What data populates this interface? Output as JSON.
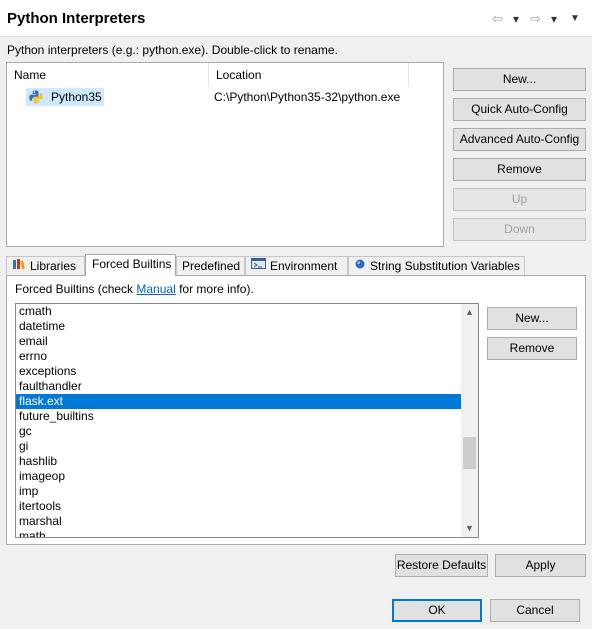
{
  "header": {
    "title": "Python Interpreters",
    "back_icon": "⇦",
    "forward_icon": "⇨",
    "dropdown_icon": "▾",
    "menu_icon": "▼"
  },
  "description": "Python interpreters (e.g.: python.exe).   Double-click to rename.",
  "interpreters_table": {
    "columns": [
      "Name",
      "Location"
    ],
    "rows": [
      {
        "name": "Python35",
        "location": "C:\\Python\\Python35-32\\python.exe"
      }
    ]
  },
  "side_buttons": {
    "new": "New...",
    "quick_auto_config": "Quick Auto-Config",
    "advanced_auto_config": "Advanced Auto-Config",
    "remove": "Remove",
    "up": "Up",
    "down": "Down"
  },
  "tabs": [
    {
      "label": "Libraries",
      "active": false
    },
    {
      "label": "Forced Builtins",
      "active": true
    },
    {
      "label": "Predefined",
      "active": false
    },
    {
      "label": "Environment",
      "active": false
    },
    {
      "label": "String Substitution Variables",
      "active": false
    }
  ],
  "forced_builtins": {
    "info_prefix": "Forced Builtins (check ",
    "info_link": "Manual",
    "info_suffix": " for more info).",
    "items": [
      "cmath",
      "datetime",
      "email",
      "errno",
      "exceptions",
      "faulthandler",
      "flask.ext",
      "future_builtins",
      "gc",
      "gi",
      "hashlib",
      "imageop",
      "imp",
      "itertools",
      "marshal",
      "math"
    ],
    "selected": "flask.ext",
    "new_button": "New...",
    "remove_button": "Remove"
  },
  "footer": {
    "restore_defaults": "Restore Defaults",
    "apply": "Apply",
    "ok": "OK",
    "cancel": "Cancel"
  },
  "colors": {
    "selection": "#0078d7",
    "row_selection": "#cde8ff",
    "link": "#0066cc"
  }
}
